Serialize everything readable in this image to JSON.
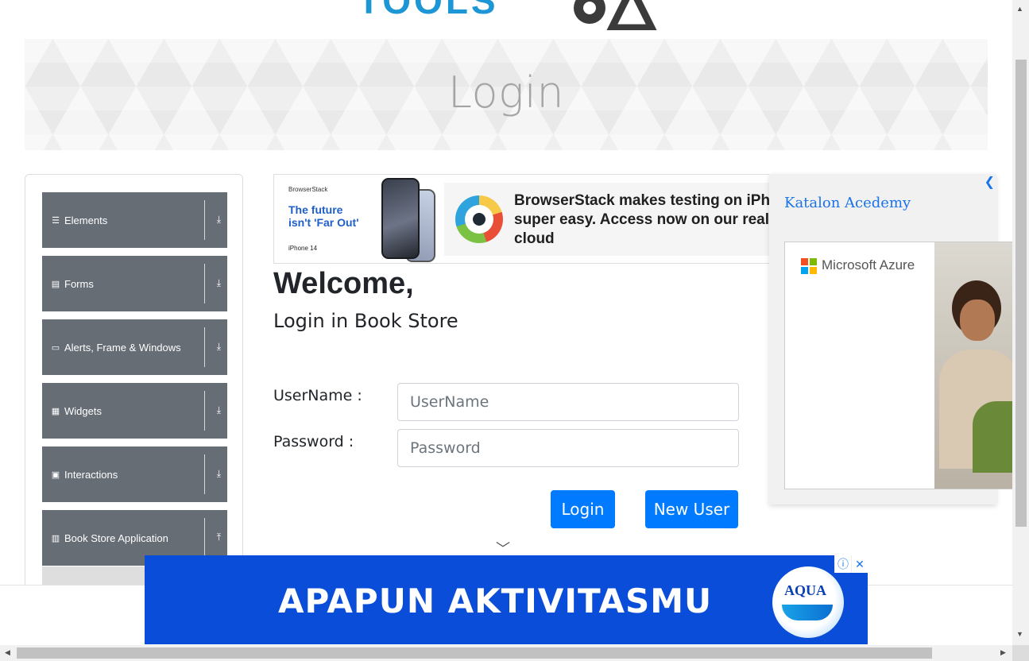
{
  "banner": {
    "title": "Login"
  },
  "logo": {
    "text": "TOOLS"
  },
  "menu": {
    "items": [
      {
        "label": "Elements",
        "icon": "☰",
        "arrow": "⤓"
      },
      {
        "label": "Forms",
        "icon": "▤",
        "arrow": "⤓"
      },
      {
        "label": "Alerts, Frame & Windows",
        "icon": "▭",
        "arrow": "⤓"
      },
      {
        "label": "Widgets",
        "icon": "▦",
        "arrow": "⤓"
      },
      {
        "label": "Interactions",
        "icon": "▣",
        "arrow": "⤓"
      },
      {
        "label": "Book Store Application",
        "icon": "▥",
        "arrow": "⤒"
      }
    ]
  },
  "ad_top": {
    "brand": "BrowserStack",
    "tagline": "The future isn't 'Far Out'",
    "device": "iPhone 14",
    "message_line1": "BrowserStack makes testing on iPho",
    "message_line2": "super easy. Access now on our real",
    "message_line3": "cloud"
  },
  "form": {
    "welcome": "Welcome,",
    "subtitle": "Login in Book Store",
    "username_label": "UserName :",
    "username_placeholder": "UserName",
    "username_value": "",
    "password_label": "Password :",
    "password_placeholder": "Password",
    "password_value": "",
    "login_button": "Login",
    "new_user_button": "New User",
    "chevron": "﹀"
  },
  "ad_right": {
    "close": "❮",
    "katalon_alt": "Katalon Acedemy",
    "azure_label": "Microsoft Azure",
    "ms_colors": [
      "#f25022",
      "#7fba00",
      "#00a4ef",
      "#ffb900"
    ]
  },
  "ad_bottom": {
    "text": "APAPUN AKTIVITASMU",
    "brand": "AQUA",
    "info": "ⓘ",
    "close": "✕"
  },
  "colors": {
    "menu_bg": "#676d75",
    "primary": "#007bff",
    "banner_text": "#a4a4a4"
  }
}
